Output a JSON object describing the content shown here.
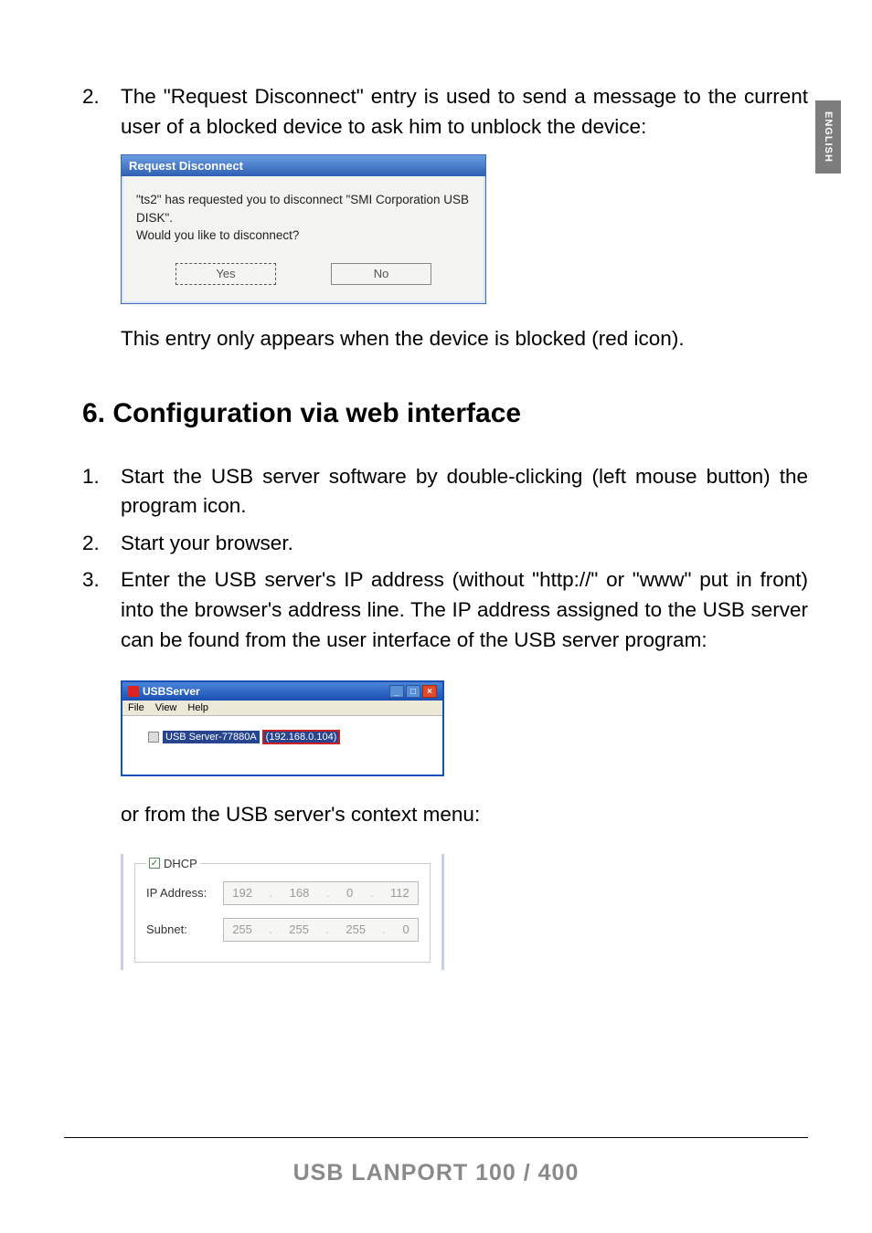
{
  "lang_tab": "ENGLISH",
  "intro": {
    "num": "2.",
    "text": "The \"Request Disconnect\" entry is used to send a message to the current user of a blocked device to ask him to unblock the device:"
  },
  "dialog1": {
    "title": "Request Disconnect",
    "line1": "\"ts2\" has requested you to disconnect \"SMI Corporation USB DISK\".",
    "line2": "Would you like to disconnect?",
    "yes": "Yes",
    "no": "No"
  },
  "after_dialog": "This entry only appears when the device is blocked (red icon).",
  "section_title": "6. Configuration via web interface",
  "steps": [
    {
      "num": "1.",
      "text": "Start the USB server software by double-clicking (left mouse button) the program icon."
    },
    {
      "num": "2.",
      "text": "Start your browser."
    },
    {
      "num": "3.",
      "text": "Enter the USB server's IP address (without \"http://\" or \"www\" put in front) into the browser's address line. The IP address assigned to the USB server can be found from the user interface of the USB server program:"
    }
  ],
  "usbserver_win": {
    "title": "USBServer",
    "menu": [
      "File",
      "View",
      "Help"
    ],
    "tree_label": "USB Server-77880A",
    "tree_ip": "(192.168.0.104)"
  },
  "context_line": "or from the USB server's context menu:",
  "form": {
    "dhcp": "DHCP",
    "ip_label": "IP Address:",
    "ip": [
      "192",
      "168",
      "0",
      "112"
    ],
    "subnet_label": "Subnet:",
    "subnet": [
      "255",
      "255",
      "255",
      "0"
    ]
  },
  "footer": "USB LANPORT 100 / 400"
}
